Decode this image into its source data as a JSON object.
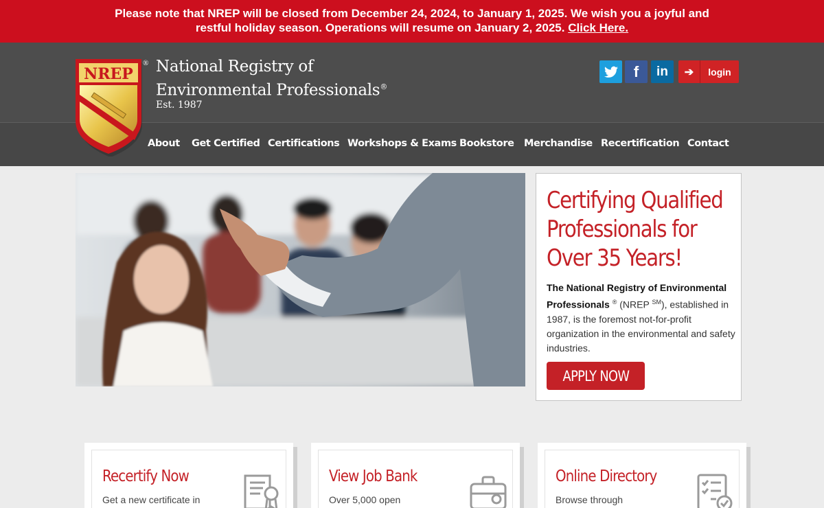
{
  "alert": {
    "line1": "Please note that NREP will be closed from December 24, 2024, to January 1, 2025. We wish you a joyful and",
    "line2": "restful holiday season. Operations will resume on January 2, 2025.",
    "link": "Click Here."
  },
  "header": {
    "logo_text": "NREP",
    "org_line1": "National Registry of",
    "org_line2": "Environmental Professionals",
    "registered": "®",
    "est": "Est. 1987",
    "login_label": "login",
    "social": [
      "twitter-icon",
      "facebook-icon",
      "linkedin-icon"
    ]
  },
  "nav": {
    "items": [
      "About",
      "Get Certified",
      "Certifications",
      "Workshops & Exams",
      "Bookstore",
      "Merchandise",
      "Recertification",
      "Contact"
    ]
  },
  "hero": {
    "title": "Certifying Qualified Professionals for Over 35 Years!",
    "body_bold1": "The National Registry of Environmental",
    "body_bold2": "Professionals",
    "body_reg": "®",
    "body_open": "(NREP",
    "body_sm": "SM",
    "body_rest1": "), established",
    "body_rest2": "in 1987, is the foremost not-for-profit organization in the environmental and safety industries.",
    "apply_label": "APPLY NOW"
  },
  "cards": [
    {
      "title": "Recertify Now",
      "text": "Get a new certificate in",
      "icon": "certificate-icon"
    },
    {
      "title": "View Job Bank",
      "text": "Over 5,000 open",
      "icon": "briefcase-icon"
    },
    {
      "title": "Online Directory",
      "text": "Browse through",
      "icon": "checklist-icon"
    }
  ],
  "colors": {
    "alert_red": "#cc0f1e",
    "brand_red": "#c42127",
    "header_gray": "#4d4d4d",
    "twitter": "#1d9fde",
    "facebook": "#3b5998",
    "linkedin": "#0a6aa1"
  }
}
